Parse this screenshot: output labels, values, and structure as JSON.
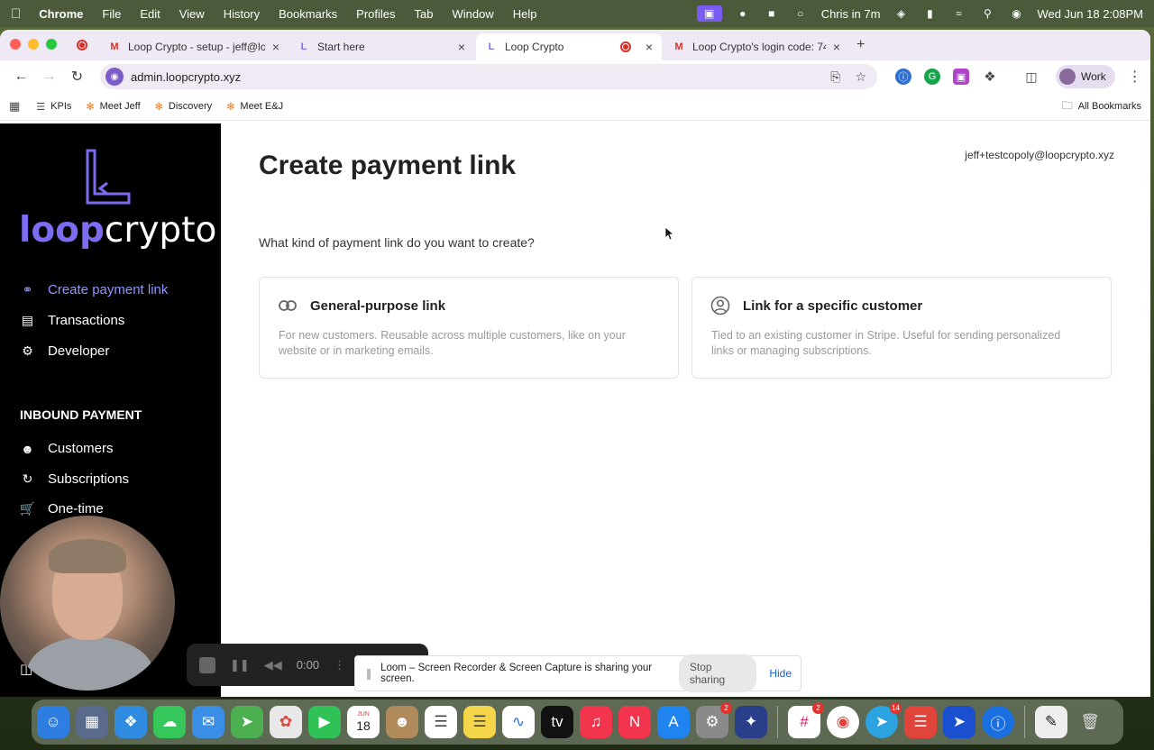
{
  "menubar": {
    "app_name": "Chrome",
    "menus": [
      "File",
      "Edit",
      "View",
      "History",
      "Bookmarks",
      "Profiles",
      "Tab",
      "Window",
      "Help"
    ],
    "meeting_status": "Chris in 7m",
    "clock": "Wed Jun 18  2:08PM"
  },
  "tabs": [
    {
      "title": "Loop Crypto - setup - jeff@lo",
      "icon": "gmail-icon"
    },
    {
      "title": "Start here",
      "icon": "loop-icon"
    },
    {
      "title": "Loop Crypto",
      "icon": "loop-icon",
      "active": true
    },
    {
      "title": "Loop Crypto's login code: 74",
      "icon": "gmail-icon"
    }
  ],
  "address": {
    "url": "admin.loopcrypto.xyz"
  },
  "profile": {
    "label": "Work"
  },
  "bookmarks": {
    "items": [
      "KPIs",
      "Meet Jeff",
      "Discovery",
      "Meet E&J"
    ],
    "all_label": "All Bookmarks"
  },
  "sidebar": {
    "logo_loop": "loop",
    "logo_crypto": "crypto",
    "nav": [
      {
        "label": "Create payment link",
        "icon": "link-icon",
        "active": true
      },
      {
        "label": "Transactions",
        "icon": "receipt-icon"
      },
      {
        "label": "Developer",
        "icon": "gear-icon"
      }
    ],
    "section_title": "INBOUND PAYMENT",
    "inbound": [
      {
        "label": "Customers",
        "icon": "users-icon"
      },
      {
        "label": "Subscriptions",
        "icon": "refresh-icon"
      },
      {
        "label": "One-time",
        "icon": "cart-icon"
      }
    ]
  },
  "main": {
    "title": "Create payment link",
    "user_email": "jeff+testcopoly@loopcrypto.xyz",
    "question": "What kind of payment link do you want to create?",
    "cards": [
      {
        "title": "General-purpose link",
        "icon": "link-icon",
        "description": "For new customers. Reusable across multiple customers, like on your website or in marketing emails."
      },
      {
        "title": "Link for a specific customer",
        "icon": "user-circle-icon",
        "description": "Tied to an existing customer in Stripe. Useful for sending personalized links or managing subscriptions."
      }
    ]
  },
  "loom": {
    "timer": "0:00",
    "share_message": "Loom – Screen Recorder & Screen Capture is sharing your screen.",
    "stop_label": "Stop sharing",
    "hide_label": "Hide"
  },
  "dock": {
    "badges": {
      "settings": "2",
      "slack": "2",
      "telegram": "14"
    },
    "calendar_month": "JUN",
    "calendar_day": "18"
  },
  "colors": {
    "brand_purple": "#7b6cf0",
    "active_nav": "#8f97ff",
    "sidebar_bg": "#000000"
  }
}
